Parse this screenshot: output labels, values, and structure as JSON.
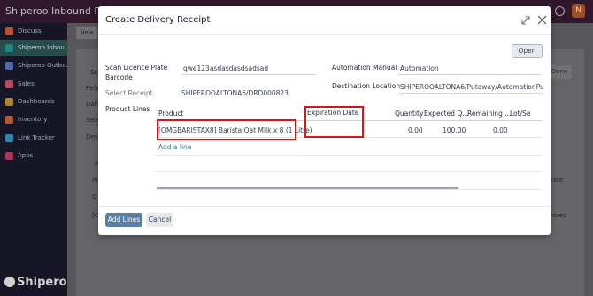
{
  "app": {
    "title": "Shiperoo Inbound Pro",
    "avatar_letter": "N"
  },
  "sidebar": {
    "items": [
      {
        "label": "Discuss",
        "color": "#e2653a"
      },
      {
        "label": "Shiperoo Inbou...",
        "color": "#2aa198"
      },
      {
        "label": "Shiperoo Outbo...",
        "color": "#6b7fd7"
      },
      {
        "label": "Sales",
        "color": "#e05c6c"
      },
      {
        "label": "Dashboards",
        "color": "#d7a13a"
      },
      {
        "label": "Inventory",
        "color": "#e0713a"
      },
      {
        "label": "Link Tracker",
        "color": "#3aa5d7"
      },
      {
        "label": "Apps",
        "color": "#d1436e"
      }
    ],
    "logo_text": "Shiperoo"
  },
  "background": {
    "new_label": "New",
    "done_label": "Done",
    "fragments": [
      "Sc",
      "Refe",
      "Date",
      "Sele",
      "Desc",
      "P",
      "Pr",
      "O",
      "[C",
      "tate",
      "losed"
    ]
  },
  "modal": {
    "title": "Create Delivery Receipt",
    "open_label": "Open",
    "fields": {
      "scan_label_line1": "Scan Licence Plate",
      "scan_label_line2": "Barcode",
      "scan_value": "qwe123asdasdasdsadsad",
      "select_receipt_label": "Select Receipt",
      "select_receipt_value": "SHIPEROOALTONA6/DRD000823",
      "product_lines_label": "Product Lines",
      "automation_manual_label": "Automation Manual",
      "automation_manual_value": "Automation",
      "destination_location_label": "Destination Location",
      "destination_location_value": "SHIPEROOALTONA6/Putaway/AutomationPutaw"
    },
    "table": {
      "headers": {
        "product": "Product",
        "expiration_date": "Expiration Date",
        "quantity": "Quantity",
        "expected_qty": "Expected Q...",
        "remaining": "Remaining ...",
        "lot_serial": "Lot/Se"
      },
      "rows": [
        {
          "product": "[OMGBARISTAX8] Barista Oat Milk x 8 (1 Litre)",
          "expiration_date": "",
          "quantity": "0.00",
          "expected_qty": "100.00",
          "remaining": "0.00",
          "lot_serial": ""
        }
      ],
      "add_line_label": "Add a line"
    },
    "footer": {
      "add_lines_label": "Add Lines",
      "cancel_label": "Cancel"
    }
  }
}
